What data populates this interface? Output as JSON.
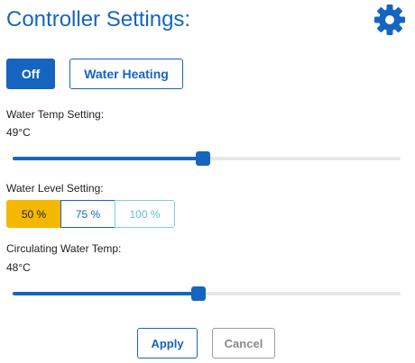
{
  "header": {
    "title": "Controller Settings:",
    "settings_icon": "gear-icon"
  },
  "mode": {
    "off_label": "Off",
    "water_heating_label": "Water Heating"
  },
  "water_temp": {
    "label": "Water Temp Setting:",
    "value_text": "49°C",
    "slider_fraction": 0.49
  },
  "water_level": {
    "label": "Water Level Setting:",
    "options": [
      "50 %",
      "75 %",
      "100 %"
    ],
    "selected": "50 %"
  },
  "circulating_temp": {
    "label": "Circulating Water Temp:",
    "value_text": "48°C",
    "slider_fraction": 0.48
  },
  "actions": {
    "apply_label": "Apply",
    "cancel_label": "Cancel"
  },
  "colors": {
    "primary": "#1565c0",
    "selected_segment": "#f5b800",
    "disabled_segment": "#5fc3cf",
    "track": "#e7e7e7",
    "cancel_text": "#8a8a8a"
  }
}
